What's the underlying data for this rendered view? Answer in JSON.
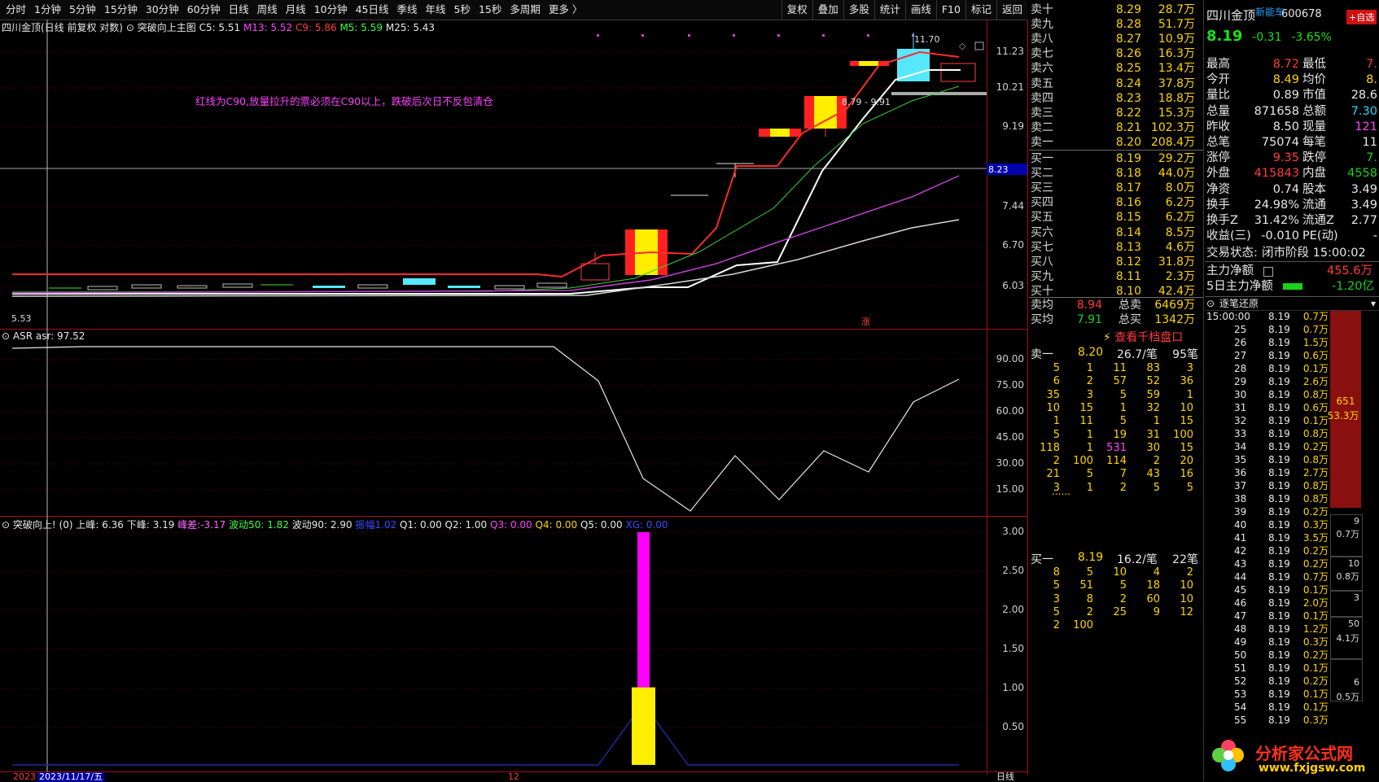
{
  "toolbar": {
    "periods": [
      "分时",
      "1分钟",
      "5分钟",
      "15分钟",
      "30分钟",
      "60分钟",
      "日线",
      "周线",
      "月线",
      "10分钟",
      "45日线",
      "季线",
      "年线",
      "5秒",
      "15秒",
      "多周期",
      "更多 〉"
    ],
    "tools": [
      "复权",
      "叠加",
      "多股",
      "统计",
      "画线",
      "F10",
      "标记",
      "返回"
    ]
  },
  "main_chart": {
    "info": {
      "title": "四川金顶(日线 前复权 对数)",
      "indicator": "突破向上主图",
      "c5": "C5: 5.51",
      "m13": "M13: 5.52",
      "c9": "C9: 5.86",
      "m5": "M5: 5.59",
      "m25": "M25: 5.43"
    },
    "annotation": "红线为C90,放量拉升的票必须在C90以上，跌破后次日不反包清仓",
    "high_label": "11.70",
    "range_label": "8.79 - 9.91",
    "low_label": "5.53",
    "marker": "涨",
    "current_price_tag": "8.23",
    "y_labels": [
      "11.23",
      "10.21",
      "9.19",
      "7.44",
      "6.70",
      "6.03"
    ]
  },
  "asr_chart": {
    "info": "ASR  asr: 97.52",
    "y_labels": [
      "90.00",
      "75.00",
      "60.00",
      "45.00",
      "30.00",
      "15.00"
    ]
  },
  "breakout_chart": {
    "info": {
      "name": "突破向上!",
      "p0": "(0)",
      "upper": "上峰: 6.36",
      "lower": "下峰: 3.19",
      "diff_label": "峰差:",
      "diff_value": "-3.17",
      "wave50": "波动50: 1.82",
      "wave90": "波动90: 2.90",
      "amp_label": "振幅",
      "amp_value": "1.02",
      "q1": "Q1: 0.00",
      "q2": "Q2: 1.00",
      "q3": "Q3: 0.00",
      "q4": "Q4: 0.00",
      "q5": "Q5: 0.00",
      "xg": "XG: 0.00"
    },
    "y_labels": [
      "3.00",
      "2.50",
      "2.00",
      "1.50",
      "1.00",
      "0.50"
    ],
    "bar_value": 3.0,
    "bar_split": 1.0
  },
  "bottom_axis": {
    "date_start": "2023",
    "date_cursor": "2023/11/17/五",
    "month_mark": "12",
    "period": "日线"
  },
  "order_book": {
    "asks": [
      {
        "name": "卖十",
        "price": "8.29",
        "vol": "28.7万"
      },
      {
        "name": "卖九",
        "price": "8.28",
        "vol": "51.7万"
      },
      {
        "name": "卖八",
        "price": "8.27",
        "vol": "10.9万"
      },
      {
        "name": "卖七",
        "price": "8.26",
        "vol": "16.3万"
      },
      {
        "name": "卖六",
        "price": "8.25",
        "vol": "13.4万"
      },
      {
        "name": "卖五",
        "price": "8.24",
        "vol": "37.8万"
      },
      {
        "name": "卖四",
        "price": "8.23",
        "vol": "18.8万"
      },
      {
        "name": "卖三",
        "price": "8.22",
        "vol": "15.3万"
      },
      {
        "name": "卖二",
        "price": "8.21",
        "vol": "102.3万"
      },
      {
        "name": "卖一",
        "price": "8.20",
        "vol": "208.4万"
      }
    ],
    "bids": [
      {
        "name": "买一",
        "price": "8.19",
        "vol": "29.2万"
      },
      {
        "name": "买二",
        "price": "8.18",
        "vol": "44.0万"
      },
      {
        "name": "买三",
        "price": "8.17",
        "vol": "8.0万"
      },
      {
        "name": "买四",
        "price": "8.16",
        "vol": "6.2万"
      },
      {
        "name": "买五",
        "price": "8.15",
        "vol": "6.2万"
      },
      {
        "name": "买六",
        "price": "8.14",
        "vol": "8.5万"
      },
      {
        "name": "买七",
        "price": "8.13",
        "vol": "4.6万"
      },
      {
        "name": "买八",
        "price": "8.12",
        "vol": "31.8万"
      },
      {
        "name": "买九",
        "price": "8.11",
        "vol": "2.3万"
      },
      {
        "name": "买十",
        "price": "8.10",
        "vol": "42.4万"
      }
    ],
    "avg_sell_label": "卖均",
    "avg_sell": "8.94",
    "total_sell_label": "总卖",
    "total_sell": "6469万",
    "avg_buy_label": "买均",
    "avg_buy": "7.91",
    "total_buy_label": "总买",
    "total_buy": "1342万",
    "thousand_link": "查看千档盘口"
  },
  "queue": {
    "sell_head": {
      "name": "卖一",
      "price": "8.20",
      "per": "26.7/笔",
      "count": "95笔"
    },
    "sell_rows": [
      [
        "5",
        "1",
        "11",
        "83",
        "3"
      ],
      [
        "6",
        "2",
        "57",
        "52",
        "36"
      ],
      [
        "35",
        "3",
        "5",
        "59",
        "1"
      ],
      [
        "10",
        "15",
        "1",
        "32",
        "10"
      ],
      [
        "1",
        "11",
        "5",
        "1",
        "15"
      ],
      [
        "5",
        "1",
        "19",
        "31",
        "100"
      ],
      [
        "118",
        "1",
        "531",
        "30",
        "15"
      ],
      [
        "2",
        "100",
        "114",
        "2",
        "20"
      ],
      [
        "21",
        "5",
        "7",
        "43",
        "16"
      ],
      [
        "3",
        "1",
        "2",
        "5",
        "5"
      ]
    ],
    "more": "......",
    "buy_head": {
      "name": "买一",
      "price": "8.19",
      "per": "16.2/笔",
      "count": "22笔"
    },
    "buy_rows": [
      [
        "8",
        "5",
        "10",
        "4",
        "2"
      ],
      [
        "5",
        "51",
        "5",
        "18",
        "10"
      ],
      [
        "3",
        "8",
        "2",
        "60",
        "10"
      ],
      [
        "5",
        "2",
        "25",
        "9",
        "12"
      ],
      [
        "2",
        "100",
        "",
        "",
        ""
      ]
    ]
  },
  "stock": {
    "name": "四川金顶",
    "tag": "新能车",
    "code": "600678",
    "fav_button": "+自选",
    "price": "8.19",
    "change": "-0.31",
    "pct": "-3.65%"
  },
  "stats": [
    [
      {
        "l": "最高",
        "v": "8.72",
        "c": "red"
      },
      {
        "l": "最低",
        "v": "7.",
        "c": "red"
      }
    ],
    [
      {
        "l": "今开",
        "v": "8.49",
        "c": "yellow"
      },
      {
        "l": "均价",
        "v": "8.",
        "c": "yellow"
      }
    ],
    [
      {
        "l": "量比",
        "v": "0.89",
        "c": "white"
      },
      {
        "l": "市值",
        "v": "28.6",
        "c": "white"
      }
    ],
    [
      {
        "l": "总量",
        "v": "871658",
        "c": "white"
      },
      {
        "l": "总额",
        "v": "7.30",
        "c": "cyan"
      }
    ],
    [
      {
        "l": "昨收",
        "v": "8.50",
        "c": "white"
      },
      {
        "l": "现量",
        "v": "121",
        "c": "mag"
      }
    ],
    [
      {
        "l": "总笔",
        "v": "75074",
        "c": "white"
      },
      {
        "l": "每笔",
        "v": "11",
        "c": "white"
      }
    ],
    [
      {
        "l": "涨停",
        "v": "9.35",
        "c": "red"
      },
      {
        "l": "跌停",
        "v": "7.",
        "c": "green"
      }
    ],
    [
      {
        "l": "外盘",
        "v": "415843",
        "c": "red"
      },
      {
        "l": "内盘",
        "v": "4558",
        "c": "green"
      }
    ],
    [
      {
        "l": "净资",
        "v": "0.74",
        "c": "white"
      },
      {
        "l": "股本",
        "v": "3.49",
        "c": "white"
      }
    ],
    [
      {
        "l": "换手",
        "v": "24.98%",
        "c": "white"
      },
      {
        "l": "流通",
        "v": "3.49",
        "c": "white"
      }
    ],
    [
      {
        "l": "换手Z",
        "v": "31.42%",
        "c": "white"
      },
      {
        "l": "流通Z",
        "v": "2.77",
        "c": "white"
      }
    ],
    [
      {
        "l": "收益(三)",
        "v": "-0.010",
        "c": "white"
      },
      {
        "l": "PE(动)",
        "v": "-",
        "c": "white"
      }
    ]
  ],
  "trade_status_label": "交易状态:",
  "trade_status_value": "闭市阶段 15:00:02",
  "main_flow_label": "主力净额",
  "main_flow_value": "455.6万",
  "flow5_label": "5日主力净额",
  "flow5_value": "-1.20亿",
  "tick_header": "逐笔还原",
  "ticks": [
    {
      "t": "15:00:00",
      "p": "8.19",
      "v": "0.7万"
    },
    {
      "t": "25",
      "p": "8.19",
      "v": "0.7万"
    },
    {
      "t": "26",
      "p": "8.19",
      "v": "1.5万"
    },
    {
      "t": "27",
      "p": "8.19",
      "v": "0.6万"
    },
    {
      "t": "28",
      "p": "8.19",
      "v": "0.1万"
    },
    {
      "t": "29",
      "p": "8.19",
      "v": "2.6万"
    },
    {
      "t": "30",
      "p": "8.19",
      "v": "0.8万"
    },
    {
      "t": "31",
      "p": "8.19",
      "v": "0.6万"
    },
    {
      "t": "32",
      "p": "8.19",
      "v": "0.1万"
    },
    {
      "t": "33",
      "p": "8.19",
      "v": "0.8万"
    },
    {
      "t": "34",
      "p": "8.19",
      "v": "0.2万"
    },
    {
      "t": "35",
      "p": "8.19",
      "v": "0.8万"
    },
    {
      "t": "36",
      "p": "8.19",
      "v": "2.7万"
    },
    {
      "t": "37",
      "p": "8.19",
      "v": "0.8万"
    },
    {
      "t": "38",
      "p": "8.19",
      "v": "0.8万"
    },
    {
      "t": "39",
      "p": "8.19",
      "v": "0.2万"
    },
    {
      "t": "40",
      "p": "8.19",
      "v": "0.3万"
    },
    {
      "t": "41",
      "p": "8.19",
      "v": "3.5万"
    },
    {
      "t": "42",
      "p": "8.19",
      "v": "0.2万"
    },
    {
      "t": "43",
      "p": "8.19",
      "v": "0.2万"
    },
    {
      "t": "44",
      "p": "8.19",
      "v": "0.7万"
    },
    {
      "t": "45",
      "p": "8.19",
      "v": "0.1万"
    },
    {
      "t": "46",
      "p": "8.19",
      "v": "2.0万"
    },
    {
      "t": "47",
      "p": "8.19",
      "v": "0.1万"
    },
    {
      "t": "48",
      "p": "8.19",
      "v": "1.2万"
    },
    {
      "t": "49",
      "p": "8.19",
      "v": "0.3万"
    },
    {
      "t": "50",
      "p": "8.19",
      "v": "0.2万"
    },
    {
      "t": "51",
      "p": "8.19",
      "v": "0.1万"
    },
    {
      "t": "52",
      "p": "8.19",
      "v": "0.2万"
    },
    {
      "t": "53",
      "p": "8.19",
      "v": "0.1万"
    },
    {
      "t": "54",
      "p": "8.19",
      "v": "0.1万"
    },
    {
      "t": "55",
      "p": "8.19",
      "v": "0.3万"
    }
  ],
  "side_bars": {
    "big_count": "651",
    "big_vol": "53.3万",
    "b1": "9",
    "b1v": "0.7万",
    "b2": "10",
    "b2v": "0.8万",
    "b3": "3",
    "b4": "50",
    "b4v": "4.1万",
    "b5": "6",
    "b5v": "0.5万"
  },
  "watermark": {
    "title": "分析家公式网",
    "url": "www.fxjgsw.com"
  },
  "colors": {
    "up": "#ff3c3c",
    "down": "#19d219",
    "price_yellow": "#ffd400",
    "panel_border": "#a01010",
    "magenta": "#ff00ff",
    "cyan_candle": "#55e8ff"
  }
}
